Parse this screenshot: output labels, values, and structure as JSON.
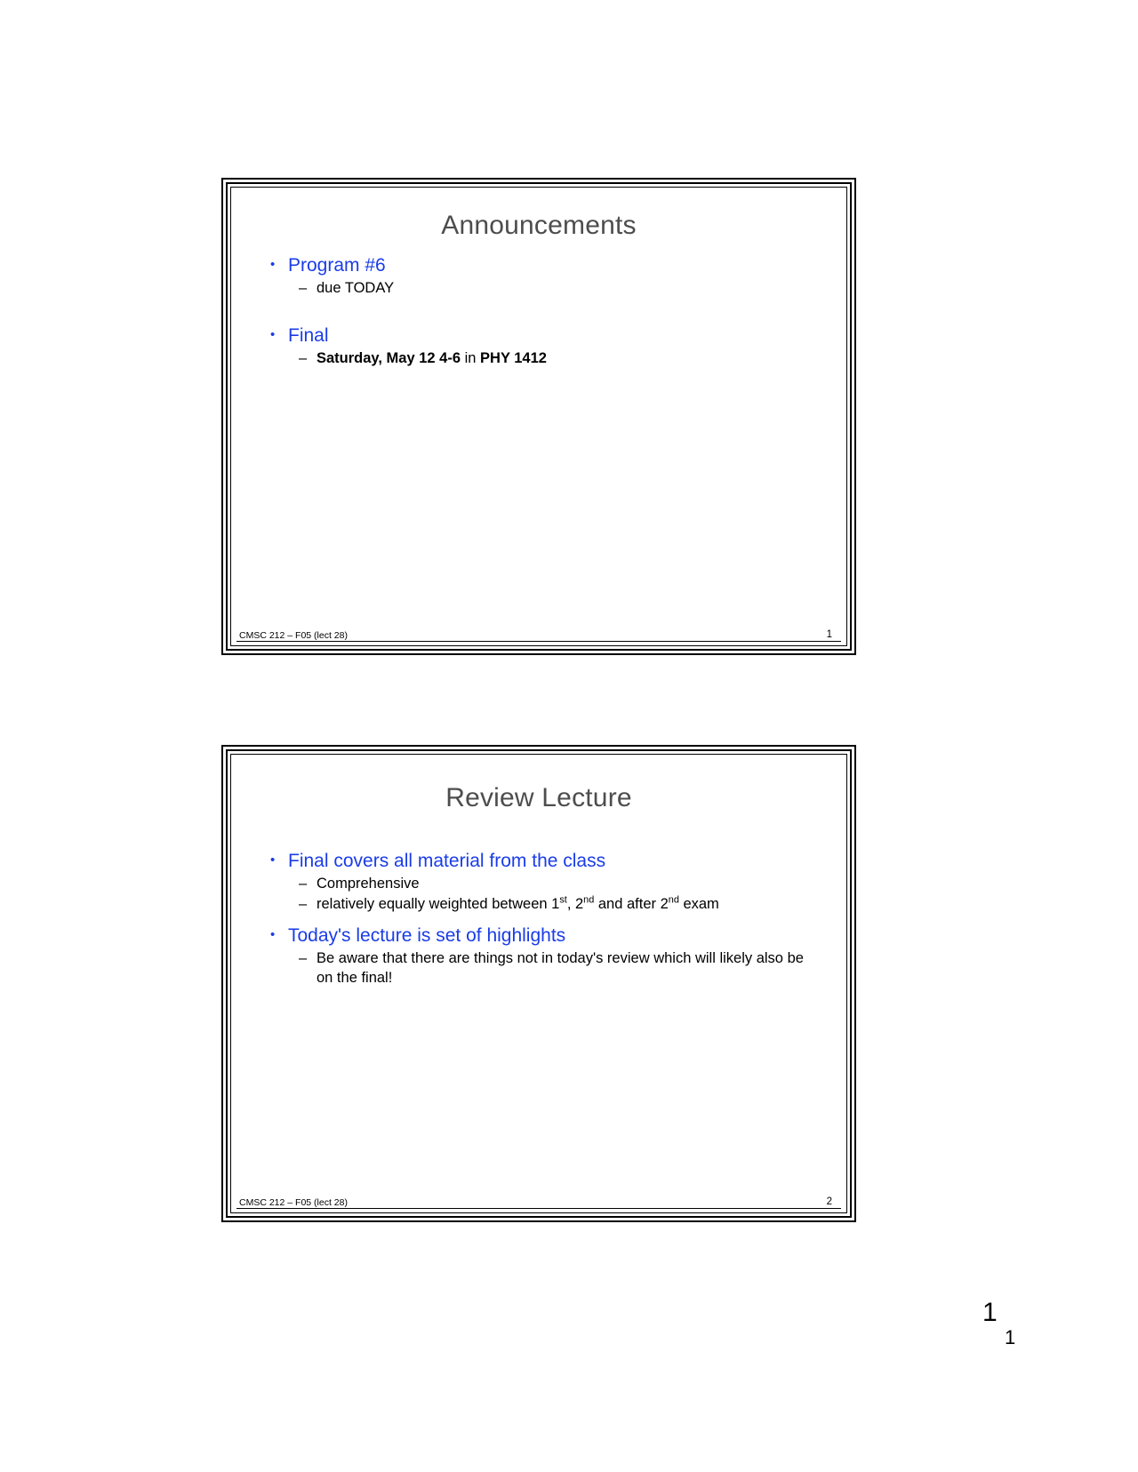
{
  "document": {
    "type": "lecture-slide-handout",
    "colors": {
      "title_gray": "#4d4d4d",
      "bullet_blue": "#1a3ce8",
      "body_black": "#000000",
      "background": "#ffffff"
    }
  },
  "slides": [
    {
      "title": "Announcements",
      "footer_text": "CMSC 212 – F05 (lect 28)",
      "page_number": "1",
      "bullets": [
        {
          "level1": "Program #6",
          "sub": [
            {
              "text": "due TODAY",
              "bold": false
            }
          ]
        },
        {
          "level1": "Final",
          "sub": [
            {
              "text": "Saturday, May 12 4-6 in PHY 1412",
              "bold": true,
              "parts": [
                {
                  "t": "Saturday, May 12 4-6",
                  "bold": true
                },
                {
                  "t": " in ",
                  "bold": false
                },
                {
                  "t": "PHY 1412",
                  "bold": true
                }
              ]
            }
          ]
        }
      ]
    },
    {
      "title": "Review Lecture",
      "footer_text": "CMSC 212 – F05 (lect 28)",
      "page_number": "2",
      "bullets": [
        {
          "level1": "Final covers all material from the class",
          "sub": [
            {
              "text": "Comprehensive",
              "bold": false
            },
            {
              "text": "relatively equally weighted between 1st, 2nd and after 2nd exam",
              "bold": false,
              "has_superscripts": true
            }
          ]
        },
        {
          "level1": "Today's lecture is set of highlights",
          "sub": [
            {
              "text": "Be aware that there are things not in today's review which will likely also be on the final!",
              "bold": false
            }
          ]
        }
      ]
    }
  ],
  "page_markers": {
    "big": "1",
    "small": "1"
  },
  "glyphs": {
    "bullet_dot": "•",
    "dash": "–"
  }
}
